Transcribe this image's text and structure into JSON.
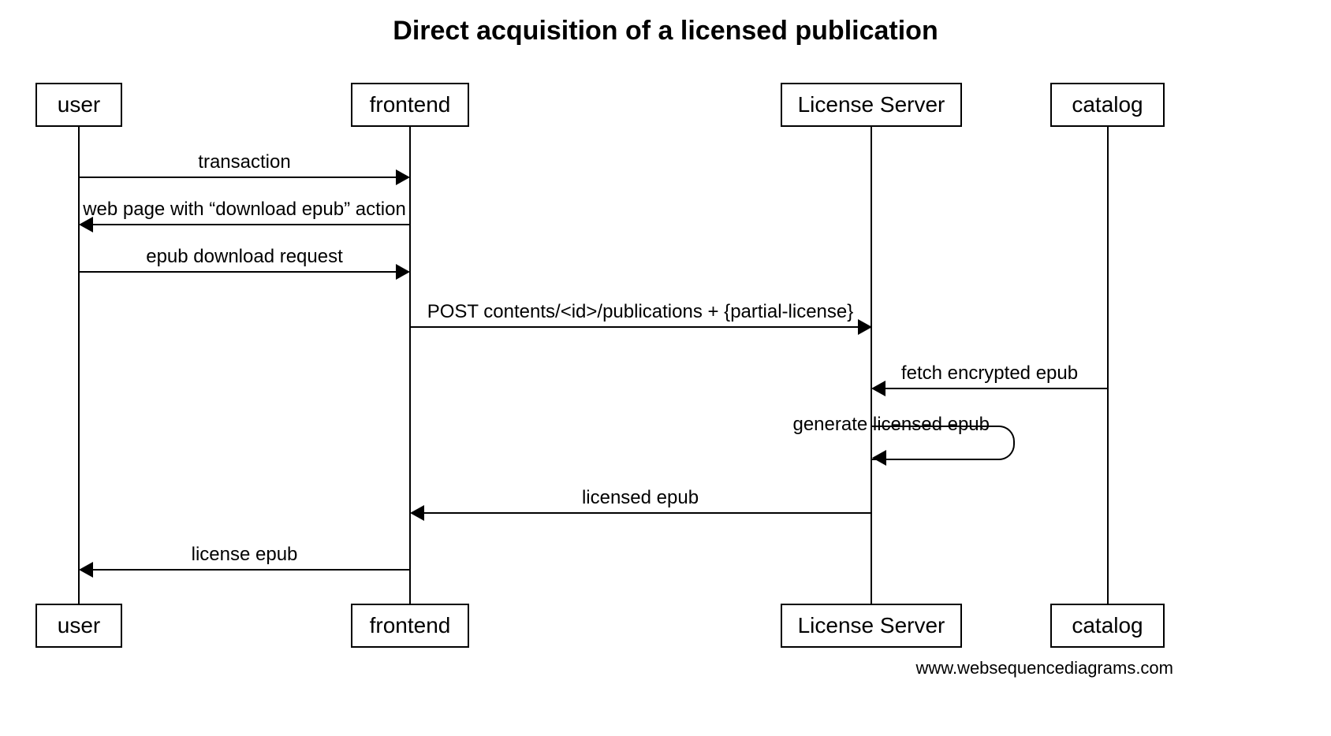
{
  "title": "Direct acquisition of a licensed publication",
  "actors": {
    "user": "user",
    "frontend": "frontend",
    "license_server": "License Server",
    "catalog": "catalog"
  },
  "messages": {
    "m1": "transaction",
    "m2": "web page with “download epub” action",
    "m3": "epub download request",
    "m4": "POST contents/<id>/publications + {partial-license}",
    "m5": "fetch encrypted epub",
    "m6": "generate licensed epub",
    "m7": "licensed epub",
    "m8": "license epub"
  },
  "footer": "www.websequencediagrams.com",
  "chart_data": {
    "type": "sequence-diagram",
    "title": "Direct acquisition of a licensed publication",
    "participants": [
      "user",
      "frontend",
      "License Server",
      "catalog"
    ],
    "messages": [
      {
        "from": "user",
        "to": "frontend",
        "label": "transaction"
      },
      {
        "from": "frontend",
        "to": "user",
        "label": "web page with “download epub” action"
      },
      {
        "from": "user",
        "to": "frontend",
        "label": "epub download request"
      },
      {
        "from": "frontend",
        "to": "License Server",
        "label": "POST contents/<id>/publications + {partial-license}"
      },
      {
        "from": "catalog",
        "to": "License Server",
        "label": "fetch encrypted epub"
      },
      {
        "from": "License Server",
        "to": "License Server",
        "label": "generate licensed epub"
      },
      {
        "from": "License Server",
        "to": "frontend",
        "label": "licensed epub"
      },
      {
        "from": "frontend",
        "to": "user",
        "label": "license epub"
      }
    ],
    "footer": "www.websequencediagrams.com"
  }
}
